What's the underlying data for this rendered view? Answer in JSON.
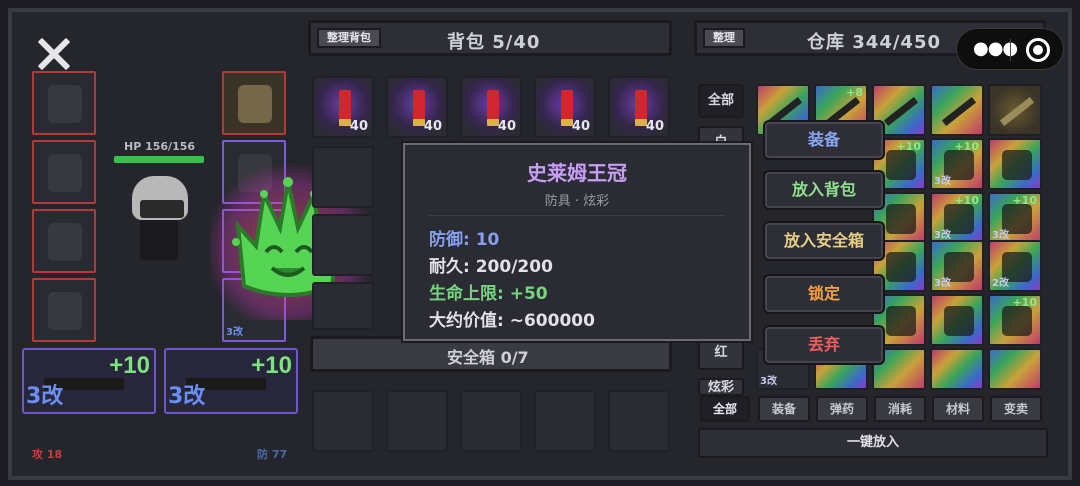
{
  "player": {
    "hp": "HP 156/156",
    "hp_fraction": 1.0,
    "attack": "攻 18",
    "defense": "防 77"
  },
  "weapons": [
    {
      "bonus": "+10",
      "mod": "3改"
    },
    {
      "bonus": "+10",
      "mod": "3改"
    }
  ],
  "equip_mod_badge": "3改",
  "backpack": {
    "sort_label": "整理背包",
    "title": "背包 5/40",
    "items": [
      {
        "count": "40"
      },
      {
        "count": "40"
      },
      {
        "count": "40"
      },
      {
        "count": "40"
      },
      {
        "count": "40"
      }
    ],
    "safe_title": "安全箱 0/7"
  },
  "warehouse": {
    "sort_label": "整理",
    "title": "仓库 344/450",
    "side_tabs": [
      "全部",
      "白",
      "红",
      "炫彩"
    ],
    "bottom_tabs": [
      "全部",
      "装备",
      "弹药",
      "消耗",
      "材料",
      "变卖"
    ],
    "put_all": "一键放入",
    "badges": {
      "plus8": "+8",
      "plus10": "+10",
      "mod3": "3改",
      "mod2": "2改"
    }
  },
  "tooltip": {
    "name": "史莱姆王冠",
    "subtitle": "防具 · 炫彩",
    "defense": "防御: 10",
    "durability": "耐久: 200/200",
    "max_hp": "生命上限: +50",
    "value": "大约价值: ~600000"
  },
  "menu": {
    "equip": "装备",
    "to_bag": "放入背包",
    "to_safe": "放入安全箱",
    "lock": "锁定",
    "drop": "丢弃"
  },
  "colors": {
    "accent_purple": "#c79ff2",
    "defense_blue": "#86a0ef",
    "hp_green": "#78d480",
    "danger_red": "#ef5e5e",
    "lock_orange": "#f0a045"
  },
  "icons": {
    "close": "close-icon",
    "shell": "shotgun-shell-icon",
    "crown": "slime-crown-icon",
    "more": "more-dots-icon",
    "target": "record-icon"
  }
}
